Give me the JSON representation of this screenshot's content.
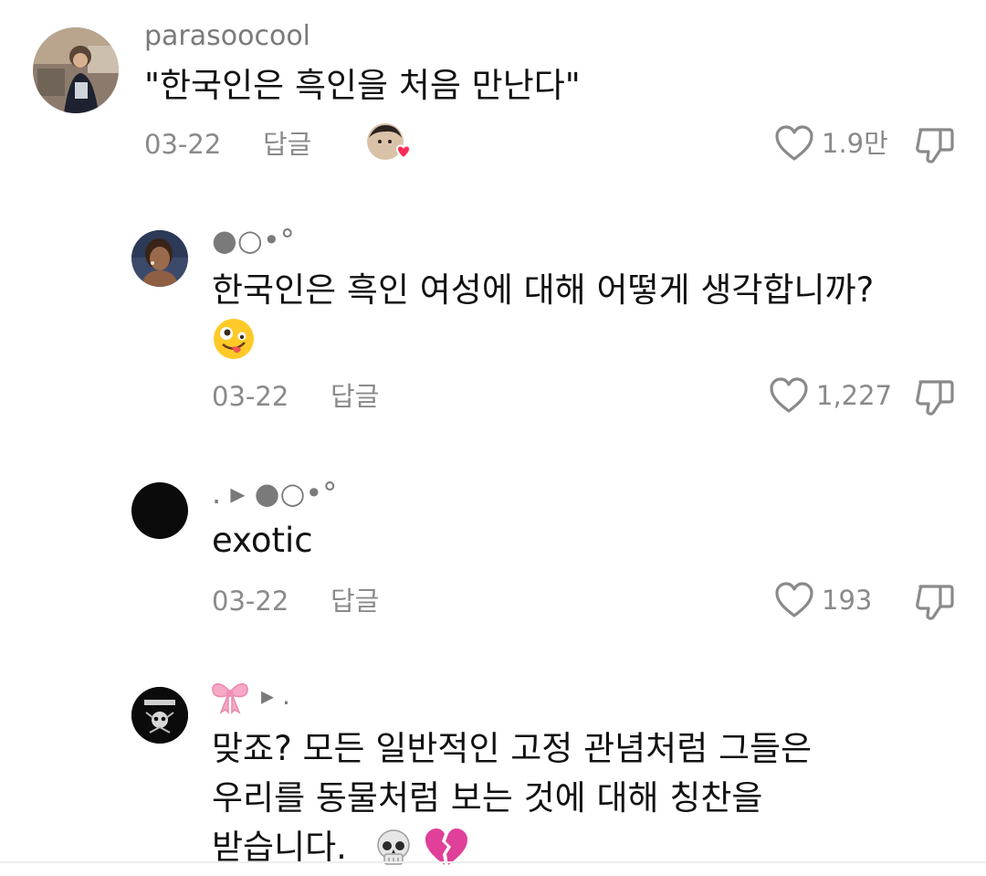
{
  "comments": [
    {
      "username": "parasoocool",
      "text": "\"한국인은 흑인을 처음 만난다\"",
      "date": "03-22",
      "reply_label": "답글",
      "likes": "1.9만"
    },
    {
      "username": "●○•°",
      "text_line1": "한국인은 흑인 여성에 대해 어떻게 생각합니까?",
      "emoji": "zany-face",
      "date": "03-22",
      "reply_label": "답글",
      "likes": "1,227"
    },
    {
      "username": ". ▸ ●○•°",
      "text": "exotic",
      "date": "03-22",
      "reply_label": "답글",
      "likes": "193"
    },
    {
      "username_suffix": "▸ .",
      "text_line1": "맞죠? 모든 일반적인 고정 관념처럼 그들은",
      "text_line2": "우리를 동물처럼 보는 것에 대해 칭찬을",
      "text_line3": "받습니다.",
      "emojis": [
        "skull",
        "broken-heart"
      ]
    }
  ],
  "colors": {
    "meta_gray": "#8a8a8a",
    "username_gray": "#7a7a7a",
    "heart_red": "#fe2c55",
    "ribbon_pink": "#f7a8c6"
  }
}
